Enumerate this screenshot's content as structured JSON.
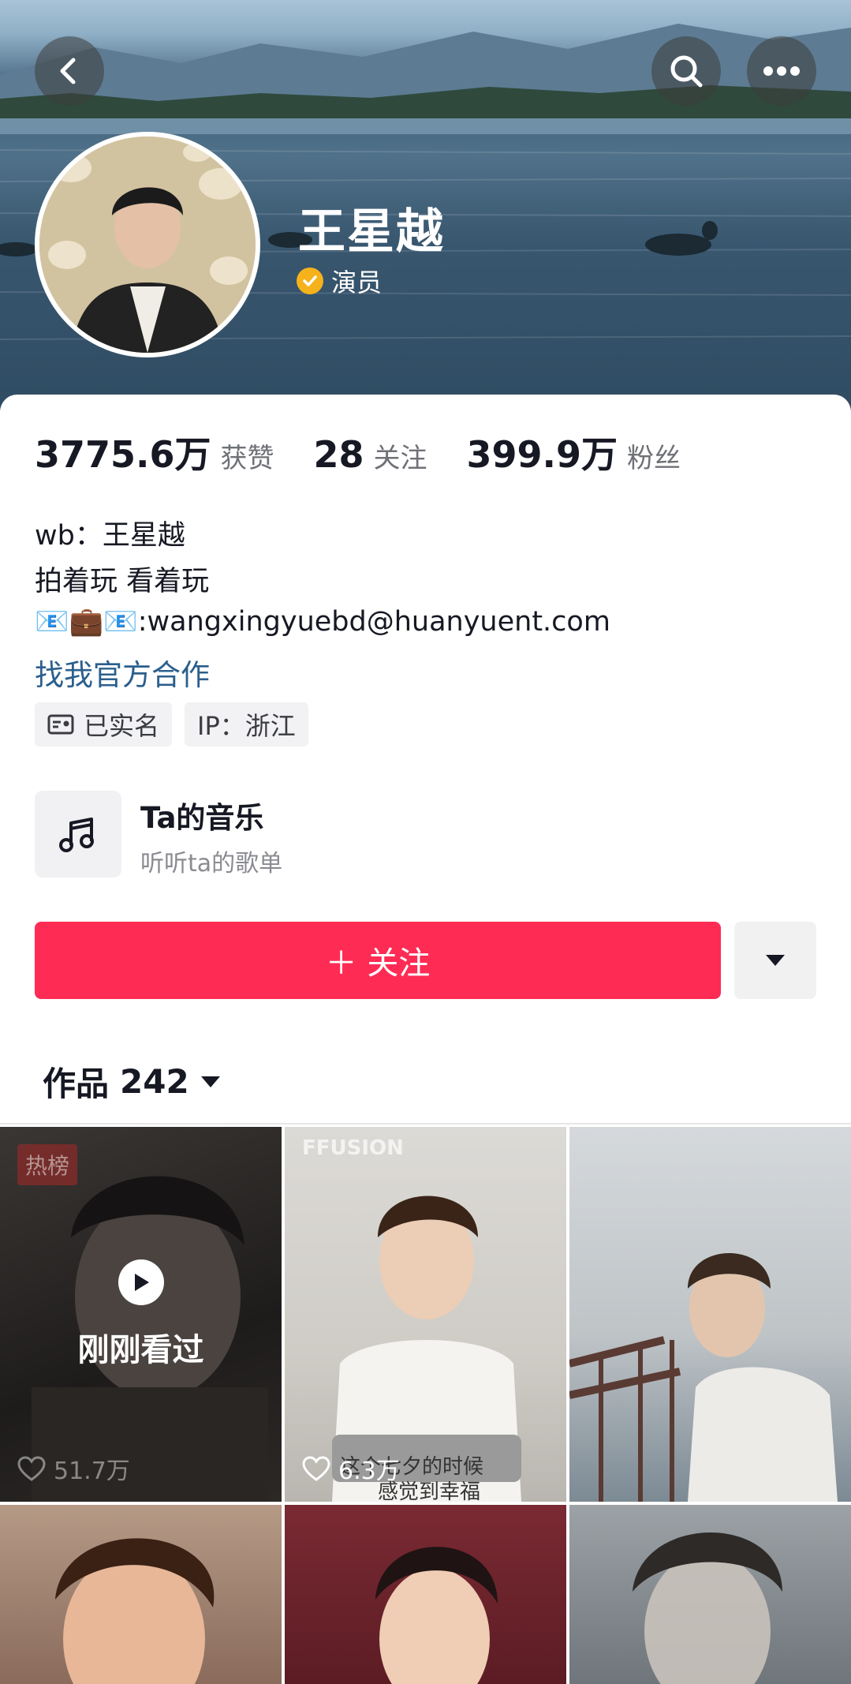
{
  "header": {
    "back_icon": "chevron-left-icon",
    "search_icon": "search-icon",
    "more_icon": "more-horizontal-icon"
  },
  "profile": {
    "name": "王星越",
    "verified_label": "演员",
    "verified_color": "#f6b21a"
  },
  "stats": [
    {
      "value": "3775.6万",
      "label": "获赞"
    },
    {
      "value": "28",
      "label": "关注"
    },
    {
      "value": "399.9万",
      "label": "粉丝"
    }
  ],
  "bio": {
    "line1": "wb：王星越",
    "line2": "拍着玩 看着玩",
    "line3_emoji": "📧💼📧",
    "line3_text": ":wangxingyuebd@huanyuent.com",
    "link": "找我官方合作"
  },
  "tags": [
    {
      "icon": "id-card-icon",
      "label": "已实名"
    },
    {
      "label": "IP：浙江"
    }
  ],
  "music": {
    "title": "Ta的音乐",
    "subtitle": "听听ta的歌单",
    "icon": "music-note-icon"
  },
  "follow": {
    "label": "＋ 关注",
    "color": "#fe2c55"
  },
  "works": {
    "label": "作品",
    "count": "242"
  },
  "videos": [
    {
      "hot_badge": "热榜",
      "overlay": "刚刚看过",
      "likes": "51.7万"
    },
    {
      "brand": "FFUSION",
      "likes": "6.3万",
      "caption_line1": "这个七夕的时候",
      "caption_line2": "感觉到幸福"
    },
    {
      "likes": ""
    },
    {},
    {},
    {}
  ]
}
